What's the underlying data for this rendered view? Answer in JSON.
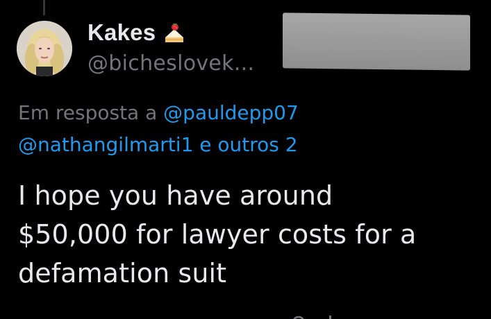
{
  "tweet": {
    "author": {
      "display_name": "Kakes",
      "name_emoji": "strawberry-shortcake-icon",
      "handle": "@bicheslovek..."
    },
    "reply_context": {
      "prefix": "Em resposta a",
      "mention_1": "@pauldepp07",
      "mention_2": "@nathangilmarti1",
      "suffix": "e outros 2"
    },
    "text_lines": [
      "I hope you have around",
      "$50,000 for lawyer costs for a",
      "defamation suit"
    ]
  },
  "colors": {
    "background": "#000000",
    "primary_text": "#e7e9ea",
    "secondary_text": "#71767b",
    "link": "#1d9bf0",
    "redaction": "#9a9a9a"
  }
}
